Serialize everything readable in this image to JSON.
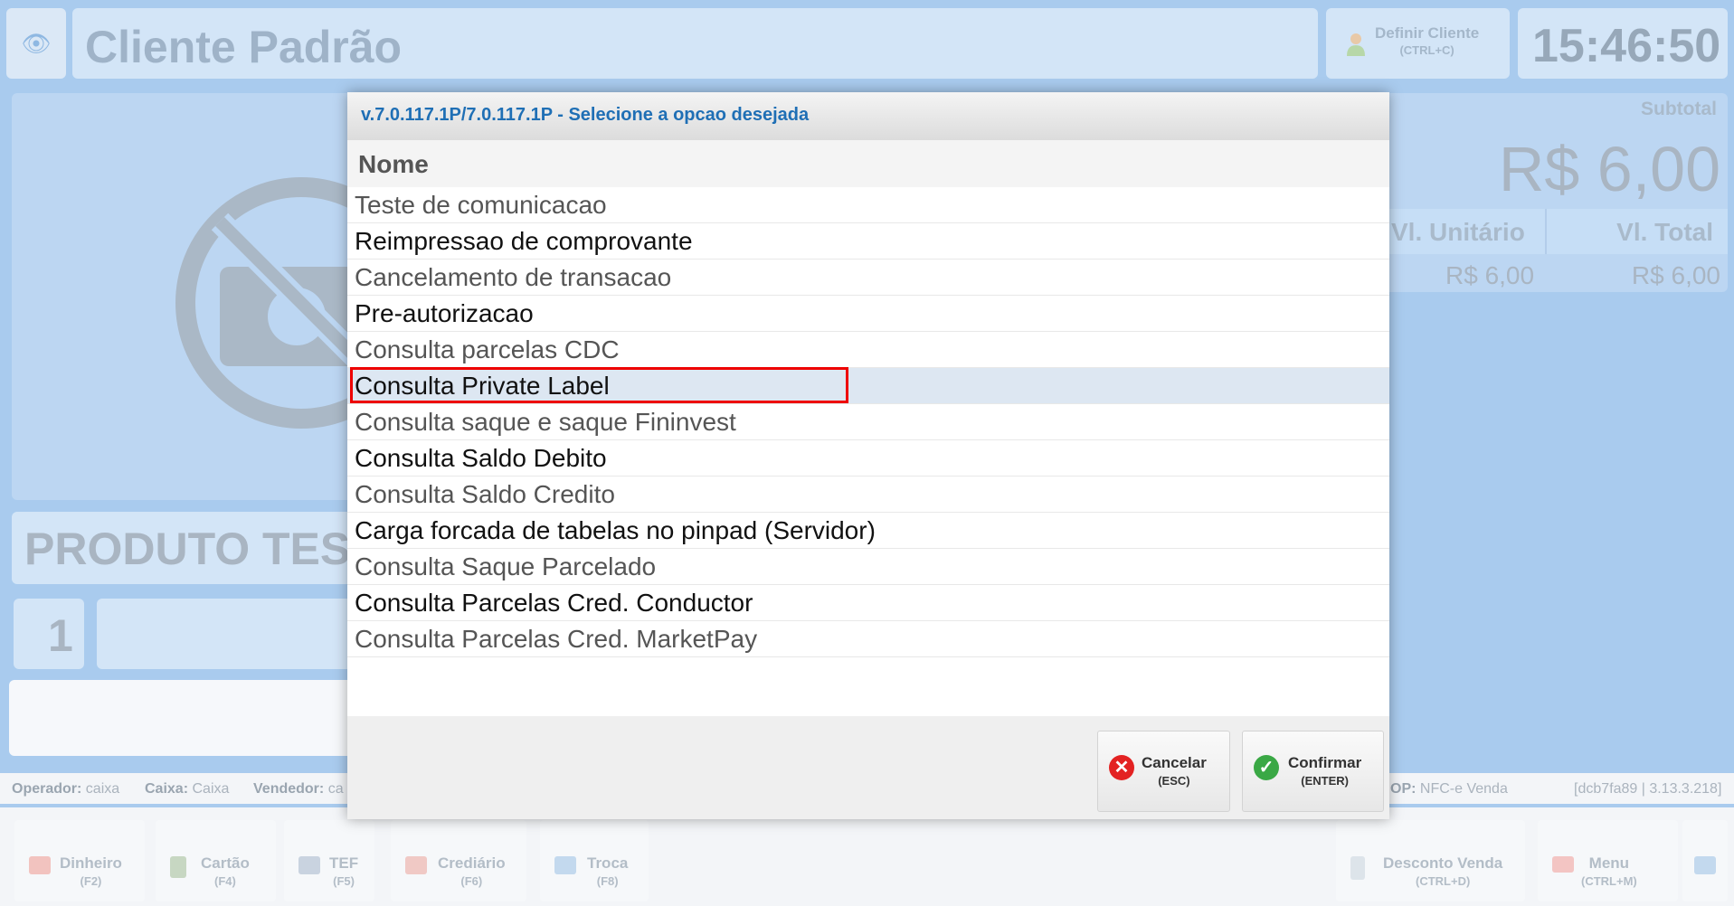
{
  "header": {
    "client_name": "Cliente Padrão",
    "define_client_label": "Definir Cliente",
    "define_client_shortcut": "(CTRL+C)",
    "clock": "15:46:50"
  },
  "sale": {
    "subtotal_label": "Subtotal",
    "subtotal_value": "R$ 6,00",
    "col_unit": "Vl. Unitário",
    "col_total": "Vl. Total",
    "unit_value": "R$ 6,00",
    "total_value": "R$ 6,00",
    "product_name": "PRODUTO TES",
    "quantity": "1"
  },
  "info_bar": {
    "operator_label": "Operador:",
    "operator_value": "caixa",
    "cashier_label": "Caixa:",
    "cashier_value": "Caixa",
    "seller_label": "Vendedor:",
    "seller_value": "ca",
    "op_label": "OP:",
    "op_value": "NFC-e Venda",
    "version_tag": "[dcb7fa89 | 3.13.3.218]"
  },
  "bottom_buttons": [
    {
      "label": "Dinheiro",
      "shortcut": "(F2)"
    },
    {
      "label": "Cartão",
      "shortcut": "(F4)"
    },
    {
      "label": "TEF",
      "shortcut": "(F5)"
    },
    {
      "label": "Crediário",
      "shortcut": "(F6)"
    },
    {
      "label": "Troca",
      "shortcut": "(F8)"
    },
    {
      "label": "Desconto Venda",
      "shortcut": "(CTRL+D)"
    },
    {
      "label": "Menu",
      "shortcut": "(CTRL+M)"
    }
  ],
  "modal": {
    "title": "v.7.0.117.1P/7.0.117.1P - Selecione a opcao desejada",
    "column_header": "Nome",
    "items": [
      "Teste de comunicacao",
      "Reimpressao de comprovante",
      "Cancelamento de transacao",
      "Pre-autorizacao",
      "Consulta parcelas CDC",
      "Consulta Private Label",
      "Consulta saque e saque Fininvest",
      "Consulta Saldo Debito",
      "Consulta Saldo Credito",
      "Carga forcada de tabelas no pinpad (Servidor)",
      "Consulta Saque Parcelado",
      "Consulta Parcelas Cred. Conductor",
      "Consulta Parcelas Cred. MarketPay"
    ],
    "selected_index": 5,
    "cancel_label": "Cancelar",
    "cancel_shortcut": "(ESC)",
    "confirm_label": "Confirmar",
    "confirm_shortcut": "(ENTER)"
  },
  "colors": {
    "accent_title": "#1f6fb5",
    "cancel_icon": "#e32222",
    "confirm_icon": "#3aa845",
    "selection_outline": "#ee0000"
  }
}
